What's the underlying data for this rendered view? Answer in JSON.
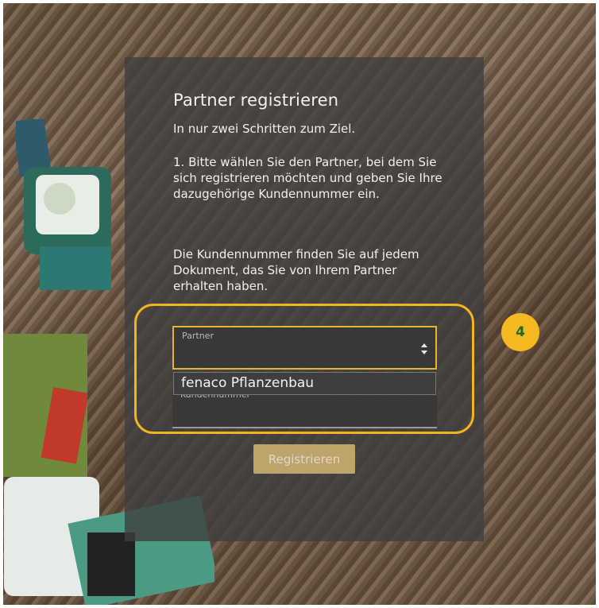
{
  "panel": {
    "title": "Partner registrieren",
    "subtitle": "In nur zwei Schritten zum Ziel.",
    "step1": "1. Bitte wählen Sie den Partner, bei dem Sie sich registrieren möchten und geben Sie Ihre dazugehörige Kundennummer ein.",
    "hint": "Die Kundennummer finden Sie auf jedem Dokument, das Sie von Ihrem Partner erhalten haben."
  },
  "form": {
    "partner_label": "Partner",
    "partner_options": [
      "fenaco Pflanzenbau"
    ],
    "kundennummer_label": "Kundennummer",
    "register_label": "Registrieren"
  },
  "annotation": {
    "step_badge": "4"
  },
  "colors": {
    "accent": "#f2b51c",
    "badge_text": "#1c6b2c",
    "button": "#bda46a",
    "panel": "#3e3e3e"
  },
  "icons": {
    "select_arrow": "select-arrow-icon"
  }
}
